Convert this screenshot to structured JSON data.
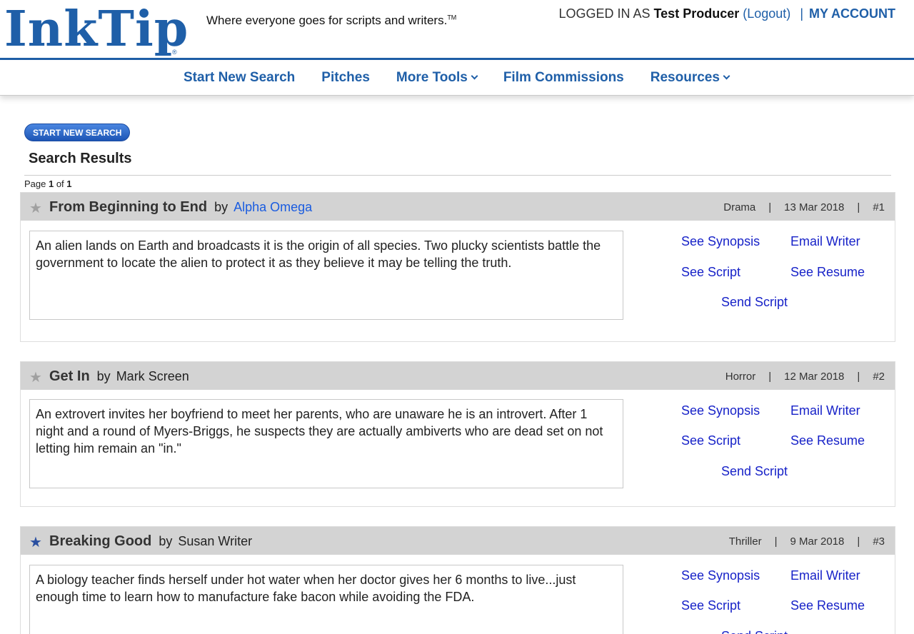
{
  "header": {
    "logo_text": "InkTip",
    "logo_reg": "®",
    "tagline": "Where everyone goes for scripts and writers.",
    "tagline_tm": "TM",
    "logged_in_label": "LOGGED IN AS ",
    "user_name": "Test Producer",
    "logout_label": "Logout",
    "separator": "|",
    "my_account_label": "MY ACCOUNT"
  },
  "nav": {
    "items": [
      {
        "label": "Start New Search"
      },
      {
        "label": "Pitches"
      },
      {
        "label": "More Tools"
      },
      {
        "label": "Film Commissions"
      },
      {
        "label": "Resources"
      }
    ]
  },
  "main": {
    "start_button": "START NEW SEARCH",
    "results_title": "Search Results",
    "page_prefix": "Page ",
    "page_current": "1",
    "page_of": " of ",
    "page_total": "1",
    "by_label": "by",
    "actions": {
      "see_synopsis": "See Synopsis",
      "email_writer": "Email Writer",
      "see_script": "See Script",
      "see_resume": "See Resume",
      "send_script": "Send Script"
    },
    "results": [
      {
        "title": "From Beginning to End",
        "author": "Alpha Omega",
        "genre": "Drama",
        "date": "13 Mar 2018",
        "rank": "#1",
        "favorited": false,
        "synopsis": "An alien lands on Earth and broadcasts it is the origin of all species. Two plucky scientists battle the government to locate the alien to protect it as they believe it may be telling the truth."
      },
      {
        "title": "Get In",
        "author": "Mark Screen",
        "genre": "Horror",
        "date": "12 Mar 2018",
        "rank": "#2",
        "favorited": false,
        "synopsis": "An extrovert invites her boyfriend to meet her parents, who are unaware he is an introvert. After 1 night and a round of Myers-Briggs, he suspects they are actually ambiverts who are dead set on not letting him remain an \"in.\""
      },
      {
        "title": "Breaking Good",
        "author": "Susan Writer",
        "genre": "Thriller",
        "date": "9 Mar 2018",
        "rank": "#3",
        "favorited": true,
        "synopsis": "A biology teacher finds herself under hot water when her doctor gives her 6 months to live...just enough time to learn how to manufacture fake bacon while avoiding the FDA."
      }
    ],
    "pipe": "|",
    "star_glyph": "★"
  },
  "colors": {
    "brand": "#1f5fa8",
    "link": "#1722c8",
    "header_bar": "#d3d3d3",
    "star_fav": "#2a4fa0",
    "star_empty": "#a0a0a0"
  }
}
